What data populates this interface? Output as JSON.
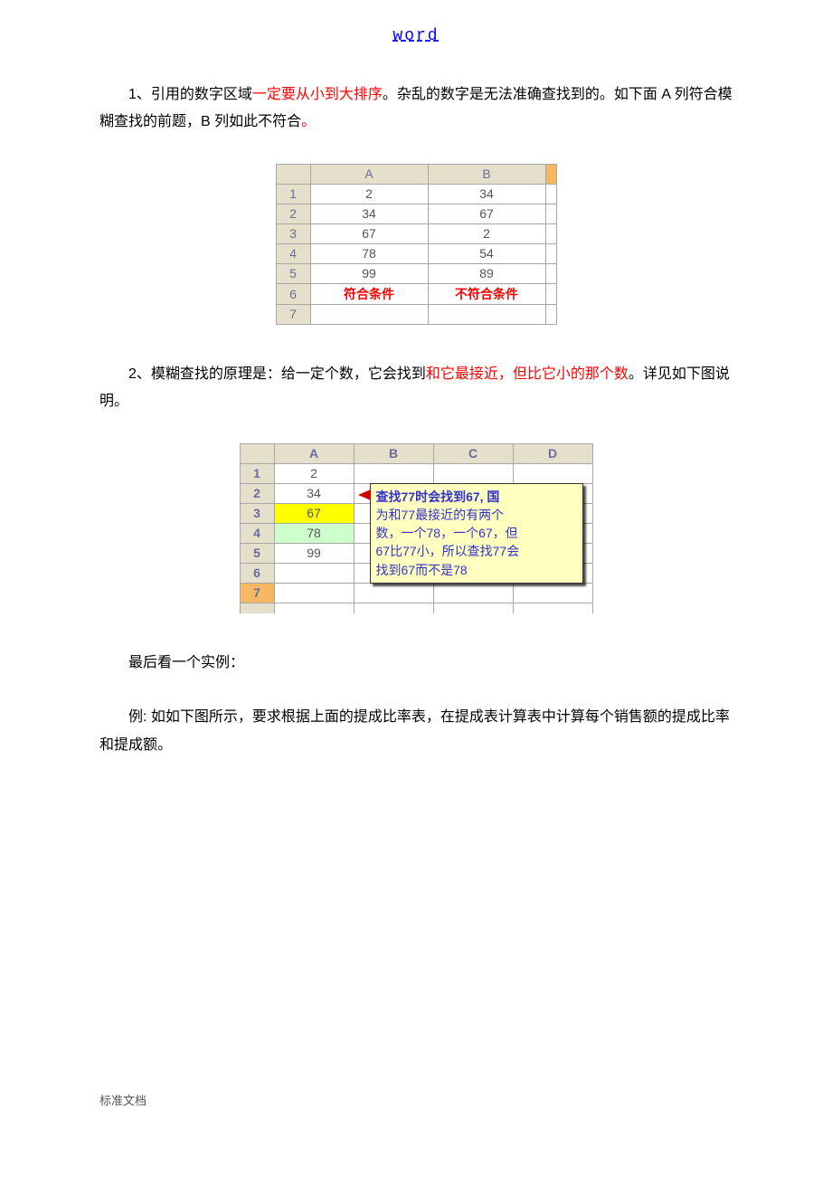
{
  "header": {
    "link": "word"
  },
  "para1": {
    "prefix": "1、引用的数字区域",
    "highlight": "一定要从小到大排序",
    "suffix": "。杂乱的数字是无法准确查找到的。如下面 A 列符合模糊查找的前题，B 列如此不符合",
    "end_mark": "。"
  },
  "table1": {
    "cols": [
      "A",
      "B"
    ],
    "rownums": [
      "1",
      "2",
      "3",
      "4",
      "5",
      "6",
      "7"
    ],
    "rows": [
      [
        "2",
        "34"
      ],
      [
        "34",
        "67"
      ],
      [
        "67",
        "2"
      ],
      [
        "78",
        "54"
      ],
      [
        "99",
        "89"
      ]
    ],
    "label_row": [
      "符合条件",
      "不符合条件"
    ]
  },
  "para2": {
    "prefix": "2、模糊查找的原理是：给一定个数，它会找到",
    "highlight": "和它最接近，但比它小的那个数",
    "suffix": "。详见如下图说明。"
  },
  "table2": {
    "cols": [
      "A",
      "B",
      "C",
      "D"
    ],
    "rownums": [
      "1",
      "2",
      "3",
      "4",
      "5",
      "6",
      "7"
    ],
    "colA": [
      "2",
      "34",
      "67",
      "78",
      "99",
      "",
      ""
    ]
  },
  "tooltip": {
    "line1": "查找77时会找到67,  国",
    "line2": "为和77最接近的有两个",
    "line3": "数，一个78，一个67，但",
    "line4": "67比77小，所以查找77会",
    "line5": "找到67而不是78"
  },
  "para3": "最后看一个实例：",
  "para4": "例: 如如下图所示，要求根据上面的提成比率表，在提成表计算表中计算每个销售额的提成比率和提成额。",
  "footer": "标准文档"
}
